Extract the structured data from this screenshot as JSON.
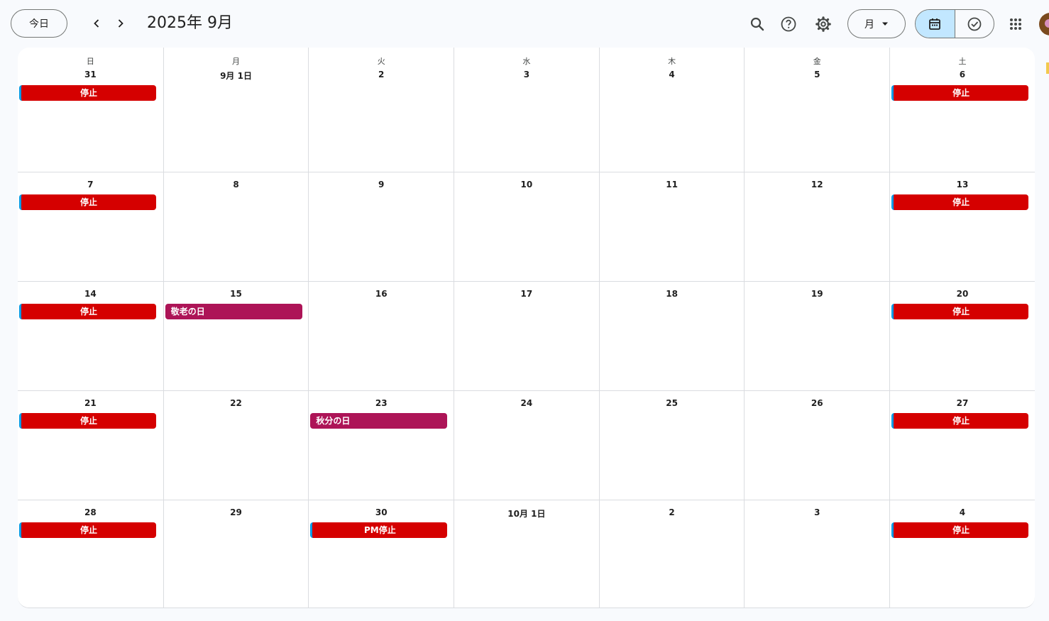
{
  "toolbar": {
    "today_label": "今日",
    "title": "2025年 9月",
    "view_label": "月",
    "icons": [
      "chevron-left-icon",
      "chevron-right-icon",
      "search-icon",
      "help-icon",
      "settings-icon",
      "calendar-icon",
      "tasks-icon",
      "apps-icon"
    ]
  },
  "colors": {
    "stop_event": "#d50000",
    "holiday_event": "#ad1457",
    "event_accent": "#039be5",
    "toggle_active": "#c2e7ff"
  },
  "calendar": {
    "weekdays": [
      "日",
      "月",
      "火",
      "水",
      "木",
      "金",
      "土"
    ],
    "weeks": [
      {
        "days": [
          {
            "label": "31",
            "events": [
              {
                "title": "停止",
                "kind": "stop"
              }
            ]
          },
          {
            "label": "9月 1日",
            "events": []
          },
          {
            "label": "2",
            "events": []
          },
          {
            "label": "3",
            "events": []
          },
          {
            "label": "4",
            "events": []
          },
          {
            "label": "5",
            "events": []
          },
          {
            "label": "6",
            "events": [
              {
                "title": "停止",
                "kind": "stop"
              }
            ]
          }
        ]
      },
      {
        "days": [
          {
            "label": "7",
            "events": [
              {
                "title": "停止",
                "kind": "stop"
              }
            ]
          },
          {
            "label": "8",
            "events": []
          },
          {
            "label": "9",
            "events": []
          },
          {
            "label": "10",
            "events": []
          },
          {
            "label": "11",
            "events": []
          },
          {
            "label": "12",
            "events": []
          },
          {
            "label": "13",
            "events": [
              {
                "title": "停止",
                "kind": "stop"
              }
            ]
          }
        ]
      },
      {
        "days": [
          {
            "label": "14",
            "events": [
              {
                "title": "停止",
                "kind": "stop"
              }
            ]
          },
          {
            "label": "15",
            "events": [
              {
                "title": "敬老の日",
                "kind": "holiday"
              }
            ]
          },
          {
            "label": "16",
            "events": []
          },
          {
            "label": "17",
            "events": []
          },
          {
            "label": "18",
            "events": []
          },
          {
            "label": "19",
            "events": []
          },
          {
            "label": "20",
            "events": [
              {
                "title": "停止",
                "kind": "stop"
              }
            ]
          }
        ]
      },
      {
        "days": [
          {
            "label": "21",
            "events": [
              {
                "title": "停止",
                "kind": "stop"
              }
            ]
          },
          {
            "label": "22",
            "events": []
          },
          {
            "label": "23",
            "events": [
              {
                "title": "秋分の日",
                "kind": "holiday"
              }
            ]
          },
          {
            "label": "24",
            "events": []
          },
          {
            "label": "25",
            "events": []
          },
          {
            "label": "26",
            "events": []
          },
          {
            "label": "27",
            "events": [
              {
                "title": "停止",
                "kind": "stop"
              }
            ]
          }
        ]
      },
      {
        "days": [
          {
            "label": "28",
            "events": [
              {
                "title": "停止",
                "kind": "stop"
              }
            ]
          },
          {
            "label": "29",
            "events": []
          },
          {
            "label": "30",
            "events": [
              {
                "title": "PM停止",
                "kind": "stop"
              }
            ]
          },
          {
            "label": "10月 1日",
            "events": []
          },
          {
            "label": "2",
            "events": []
          },
          {
            "label": "3",
            "events": []
          },
          {
            "label": "4",
            "events": [
              {
                "title": "停止",
                "kind": "stop"
              }
            ]
          }
        ]
      }
    ]
  }
}
